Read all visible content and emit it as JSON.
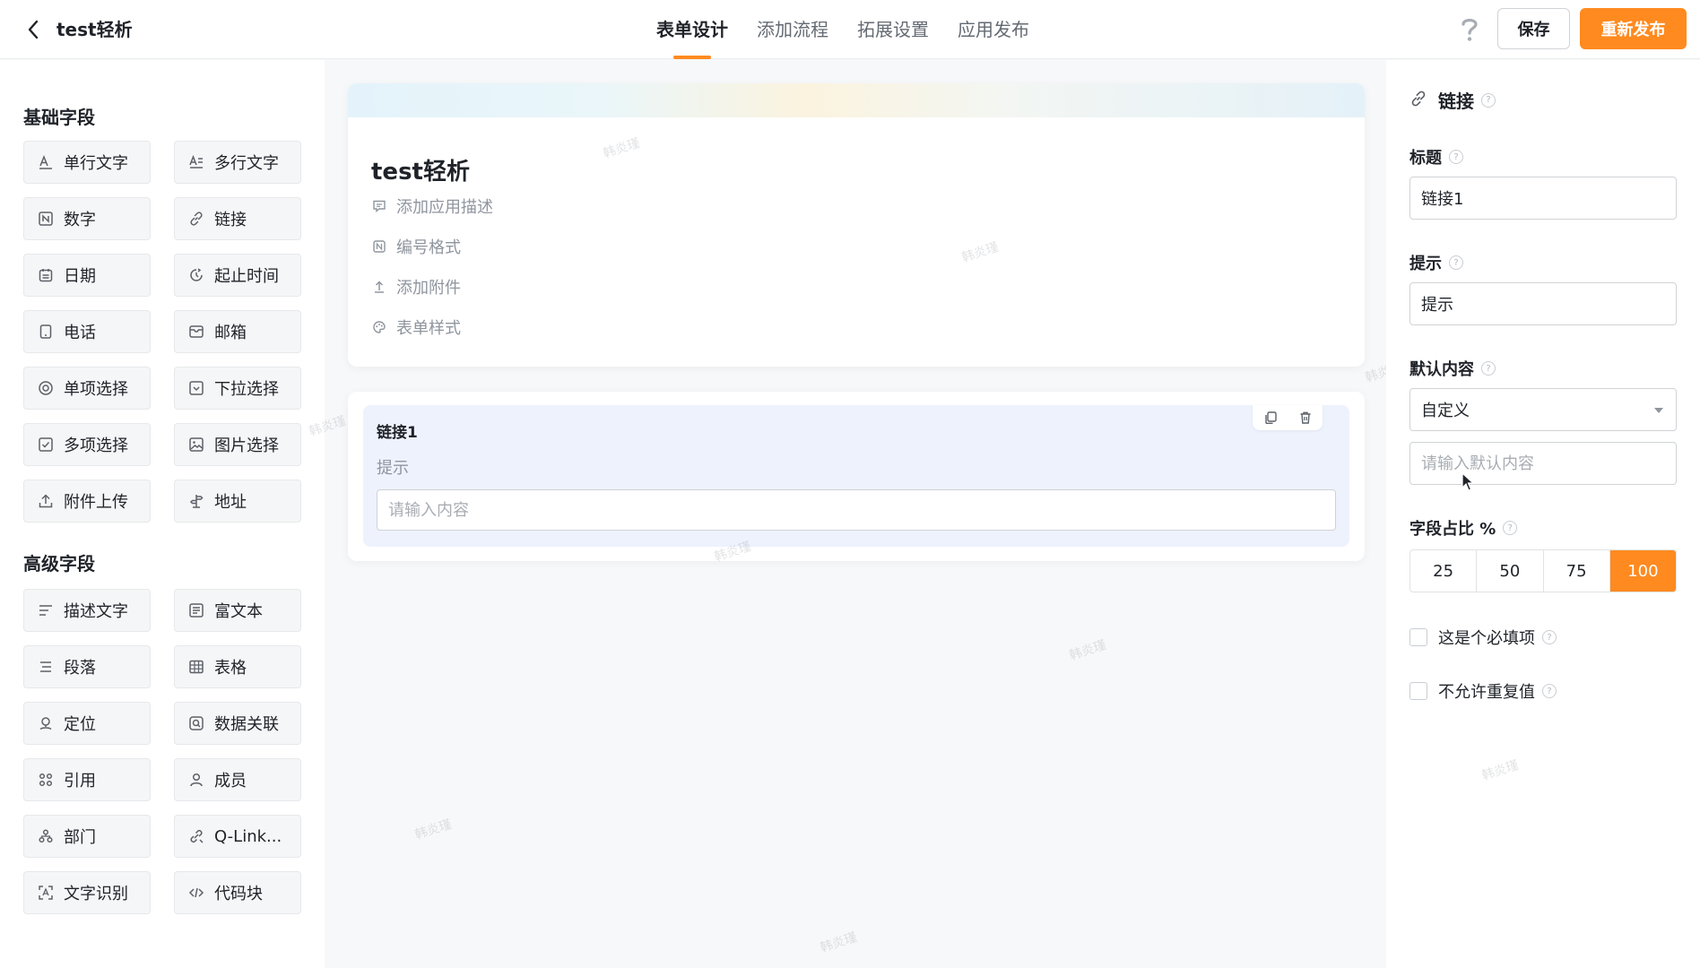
{
  "header": {
    "title": "test轻析",
    "tabs": [
      {
        "label": "表单设计",
        "active": true
      },
      {
        "label": "添加流程",
        "active": false
      },
      {
        "label": "拓展设置",
        "active": false
      },
      {
        "label": "应用发布",
        "active": false
      }
    ],
    "help_icon": "question-mark-icon",
    "save_label": "保存",
    "publish_label": "重新发布"
  },
  "left_panel": {
    "basic_title": "基础字段",
    "basic_fields": [
      {
        "label": "单行文字",
        "icon": "text-a-icon"
      },
      {
        "label": "多行文字",
        "icon": "text-lines-icon"
      },
      {
        "label": "数字",
        "icon": "number-icon"
      },
      {
        "label": "链接",
        "icon": "link-icon"
      },
      {
        "label": "日期",
        "icon": "calendar-icon"
      },
      {
        "label": "起止时间",
        "icon": "time-range-icon"
      },
      {
        "label": "电话",
        "icon": "phone-icon"
      },
      {
        "label": "邮箱",
        "icon": "mail-icon"
      },
      {
        "label": "单项选择",
        "icon": "radio-icon"
      },
      {
        "label": "下拉选择",
        "icon": "dropdown-icon"
      },
      {
        "label": "多项选择",
        "icon": "checkbox-icon"
      },
      {
        "label": "图片选择",
        "icon": "image-icon"
      },
      {
        "label": "附件上传",
        "icon": "upload-icon"
      },
      {
        "label": "地址",
        "icon": "signpost-icon"
      }
    ],
    "advanced_title": "高级字段",
    "advanced_fields": [
      {
        "label": "描述文字",
        "icon": "description-icon"
      },
      {
        "label": "富文本",
        "icon": "rich-text-icon"
      },
      {
        "label": "段落",
        "icon": "paragraph-icon"
      },
      {
        "label": "表格",
        "icon": "table-icon"
      },
      {
        "label": "定位",
        "icon": "location-icon"
      },
      {
        "label": "数据关联",
        "icon": "data-link-icon"
      },
      {
        "label": "引用",
        "icon": "reference-icon"
      },
      {
        "label": "成员",
        "icon": "user-icon"
      },
      {
        "label": "部门",
        "icon": "department-icon"
      },
      {
        "label": "Q-Link...",
        "icon": "q-link-icon"
      },
      {
        "label": "文字识别",
        "icon": "ocr-icon"
      },
      {
        "label": "代码块",
        "icon": "code-icon"
      }
    ]
  },
  "canvas": {
    "form_title": "test轻析",
    "meta": [
      {
        "label": "添加应用描述",
        "icon": "comment-icon"
      },
      {
        "label": "编号格式",
        "icon": "number-format-icon"
      },
      {
        "label": "添加附件",
        "icon": "attach-upload-icon"
      },
      {
        "label": "表单样式",
        "icon": "palette-icon"
      }
    ],
    "field": {
      "label": "链接1",
      "hint": "提示",
      "placeholder": "请输入内容"
    },
    "watermark": "韩炎瑾"
  },
  "right_panel": {
    "header_title": "链接",
    "title_label": "标题",
    "title_value": "链接1",
    "hint_label": "提示",
    "hint_value": "提示",
    "default_label": "默认内容",
    "default_select": "自定义",
    "default_placeholder": "请输入默认内容",
    "ratio_label": "字段占比 %",
    "ratio_options": [
      "25",
      "50",
      "75",
      "100"
    ],
    "ratio_selected": "100",
    "required_label": "这是个必填项",
    "no_duplicate_label": "不允许重复值"
  },
  "colors": {
    "accent": "#ff8a1f",
    "selected_field_bg": "#eef2fd"
  }
}
